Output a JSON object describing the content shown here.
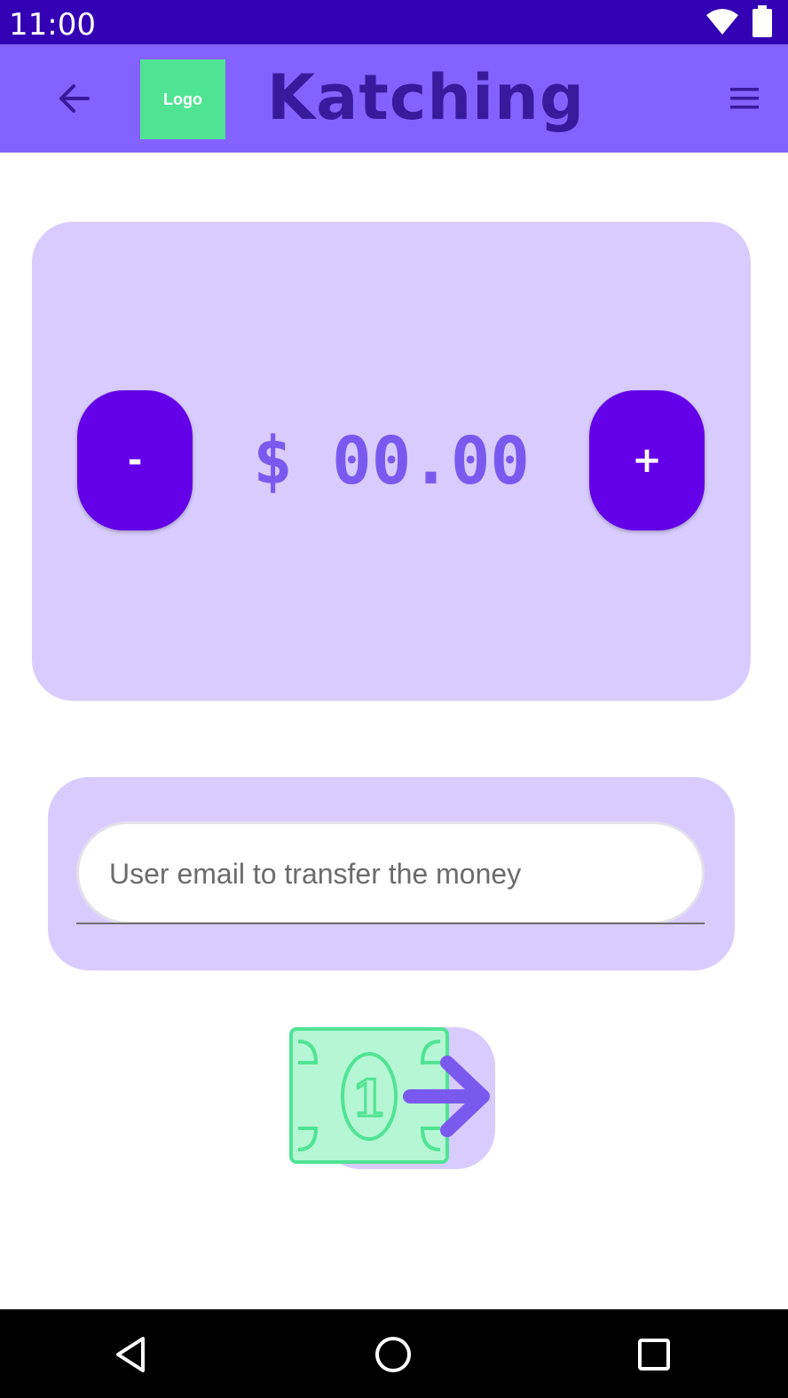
{
  "status_bar": {
    "time": "11:00",
    "icons": [
      "wifi-icon",
      "battery-icon"
    ]
  },
  "app_bar": {
    "back_icon": "arrow-left-icon",
    "logo_text": "Logo",
    "title": "Katching",
    "menu_icon": "hamburger-menu-icon"
  },
  "amount_card": {
    "minus_label": "-",
    "plus_label": "+",
    "amount": "$ 00.00"
  },
  "email_card": {
    "placeholder": "User email to transfer the money",
    "value": ""
  },
  "send_button": {
    "icon": "money-send-icon",
    "banknote_digit": "1"
  },
  "nav_bar": {
    "icons": [
      "nav-back-icon",
      "nav-home-icon",
      "nav-recents-icon"
    ]
  },
  "colors": {
    "status_bar": "#3300b3",
    "app_bar": "#8462ff",
    "title": "#3a1a9c",
    "logo_bg": "#50e394",
    "card_bg": "#d8ccff",
    "round_button": "#6400e8",
    "amount_text": "#7a5aee",
    "banknote_fill": "#b5f7d4",
    "banknote_stroke": "#50e394",
    "arrow": "#7a5aee"
  }
}
